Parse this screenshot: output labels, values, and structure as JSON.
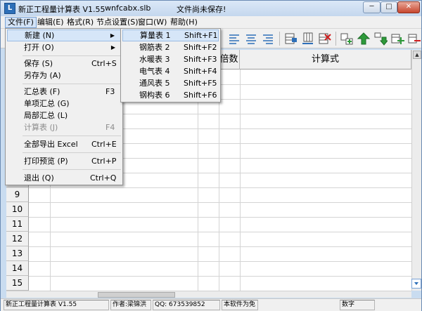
{
  "titlebar": {
    "app_title": "新正工程量计算表  V1.55",
    "file_name": "wnfcabx.slb",
    "save_status": "文件尚未保存!",
    "buttons": [
      "─",
      "□",
      "✕"
    ]
  },
  "menubar": [
    "文件(F)",
    "编辑(E)",
    "格式(R)",
    "节点设置(S)",
    "窗口(W)",
    "帮助(H)"
  ],
  "file_menu": [
    {
      "label": "新建 (N)",
      "shortcut": "",
      "submenu": true
    },
    {
      "label": "打开 (O)",
      "shortcut": "",
      "submenu": true
    },
    {
      "label": "保存    (S)",
      "shortcut": "Ctrl+S"
    },
    {
      "label": "另存为   (A)",
      "shortcut": ""
    },
    {
      "label": "汇总表    (F)",
      "shortcut": "F3"
    },
    {
      "label": "单项汇总 (G)",
      "shortcut": ""
    },
    {
      "label": "局部汇总 (L)",
      "shortcut": ""
    },
    {
      "label": "计算表    (J)",
      "shortcut": "F4",
      "disabled": true
    },
    {
      "label": "全部导出  Excel",
      "shortcut": "Ctrl+E"
    },
    {
      "label": "打印预览 (P)",
      "shortcut": "Ctrl+P"
    },
    {
      "label": "退出  (Q)",
      "shortcut": "Ctrl+Q"
    }
  ],
  "new_submenu": [
    {
      "label": "算量表 1",
      "shortcut": "Shift+F1"
    },
    {
      "label": "钢筋表 2",
      "shortcut": "Shift+F2"
    },
    {
      "label": "水暖表 3",
      "shortcut": "Shift+F3"
    },
    {
      "label": "电气表 4",
      "shortcut": "Shift+F4"
    },
    {
      "label": "通风表 5",
      "shortcut": "Shift+F5"
    },
    {
      "label": "钢构表 6",
      "shortcut": "Shift+F6"
    }
  ],
  "grid": {
    "headers": [
      "倍数",
      "计算式"
    ],
    "row_numbers": [
      "9",
      "10",
      "11",
      "12",
      "13",
      "14",
      "15"
    ]
  },
  "statusbar": [
    "新正工程量计算表  V1.55",
    "作者:梁锦洪",
    "QQ: 673539852",
    "本软件为免",
    "数字"
  ],
  "colors": {
    "title_bg": "#c4d7ee",
    "menu_highlight": "#d6e6f8",
    "close_button": "#c7462e",
    "toolbar_green": "#2e9a3a",
    "toolbar_blue": "#2d6fb8"
  }
}
